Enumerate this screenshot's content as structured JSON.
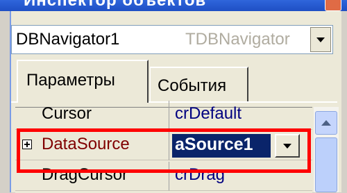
{
  "window": {
    "title": "Инспектор объектов"
  },
  "component_selector": {
    "name": "DBNavigator1",
    "type": "TDBNavigator"
  },
  "tabs": [
    {
      "label": "Параметры",
      "active": true
    },
    {
      "label": "События",
      "active": false
    }
  ],
  "properties": [
    {
      "name": "Cursor",
      "value": "crDefault"
    },
    {
      "name": "DataSource",
      "value": "aSource1",
      "expandable": true,
      "selected": true
    },
    {
      "name": "DragCursor",
      "value": "crDrag"
    }
  ],
  "colors": {
    "highlight": "#ff0000",
    "selection": "#0a246a",
    "reference_property": "#800000"
  }
}
